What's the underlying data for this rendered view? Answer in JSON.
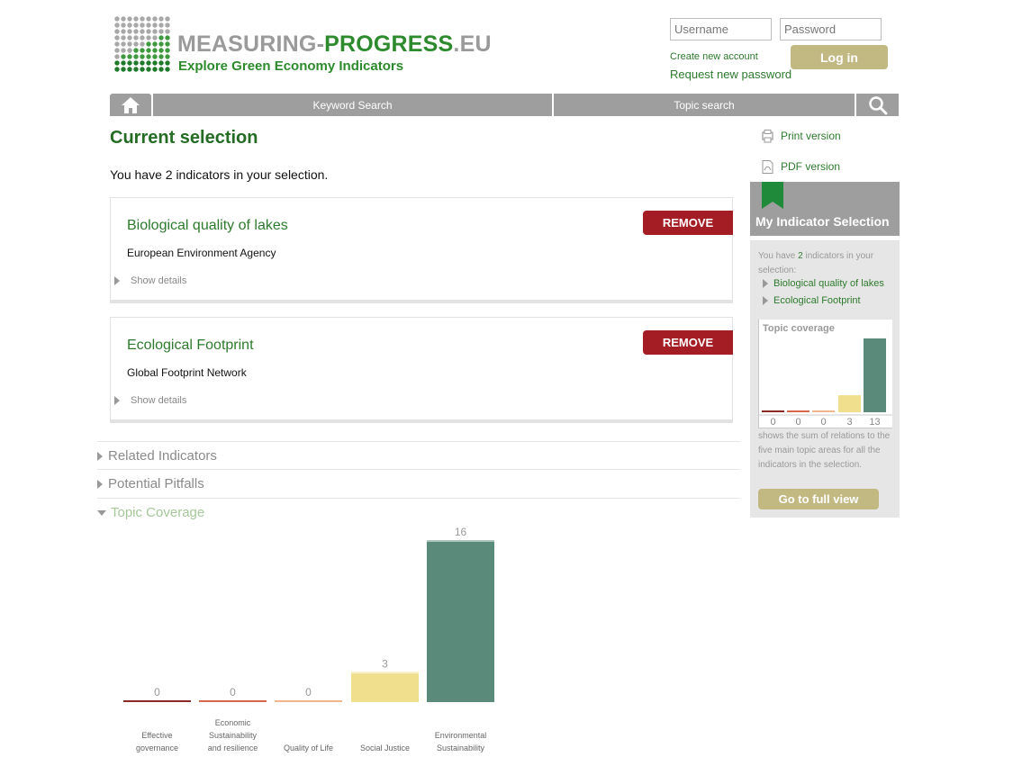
{
  "header": {
    "logo_title_gray": "MEASURING-",
    "logo_title_green": "PROGRESS",
    "logo_title_suffix": ".EU",
    "logo_subtitle": "Explore Green Economy Indicators"
  },
  "login": {
    "username_placeholder": "Username",
    "password_placeholder": "Password",
    "create_account": "Create new account",
    "request_password": "Request new password",
    "login_button": "Log in"
  },
  "nav": {
    "home_icon": "home-icon",
    "keyword_search": "Keyword Search",
    "topic_search": "Topic search",
    "search_icon": "search-icon"
  },
  "main": {
    "title": "Current selection",
    "count_text": "You have 2 indicators in your selection.",
    "indicators": [
      {
        "title": "Biological quality of lakes",
        "org": "European Environment Agency",
        "details": "Show details",
        "remove": "REMOVE"
      },
      {
        "title": "Ecological Footprint",
        "org": "Global Footprint Network",
        "details": "Show details",
        "remove": "REMOVE"
      }
    ],
    "sections": [
      {
        "label": "Related Indicators",
        "expanded": false
      },
      {
        "label": "Potential Pitfalls",
        "expanded": false
      },
      {
        "label": "Topic Coverage",
        "expanded": true
      }
    ]
  },
  "sidebar": {
    "print": "Print version",
    "pdf": "PDF version",
    "title": "My Indicator Selection",
    "text_pre": "You have ",
    "text_num": "2",
    "text_post": " indicators in your selection:",
    "items": [
      "Biological quality of lakes",
      "Ecological Footprint"
    ],
    "chart_label": "Topic coverage",
    "note": "shows the sum of relations to the five main topic areas for all the indicators in the selection.",
    "full_view": "Go to full view"
  },
  "colors": {
    "effective_governance": "#8b2a24",
    "economic_sustainability": "#d9684a",
    "quality_of_life": "#f2b48a",
    "social_justice": "#f0e08e",
    "environmental_sustainability": "#5a8b7a"
  },
  "chart_data": [
    {
      "type": "bar",
      "categories": [
        "Effective governance",
        "Economic Sustainability and resilience",
        "Quality of Life",
        "Social Justice",
        "Environmental Sustainability"
      ],
      "values": [
        0,
        0,
        0,
        3,
        16
      ],
      "colors": [
        "#8b2a24",
        "#d9684a",
        "#f2b48a",
        "#f0e08e",
        "#5a8b7a"
      ],
      "title": "",
      "xlabel": "",
      "ylabel": ""
    },
    {
      "type": "bar",
      "categories": [
        "",
        "",
        "",
        "",
        ""
      ],
      "values": [
        0,
        0,
        0,
        3,
        13
      ],
      "colors": [
        "#8b2a24",
        "#d9684a",
        "#f2b48a",
        "#f0e08e",
        "#5a8b7a"
      ],
      "title": "Topic coverage",
      "xlabel": "",
      "ylabel": ""
    }
  ]
}
